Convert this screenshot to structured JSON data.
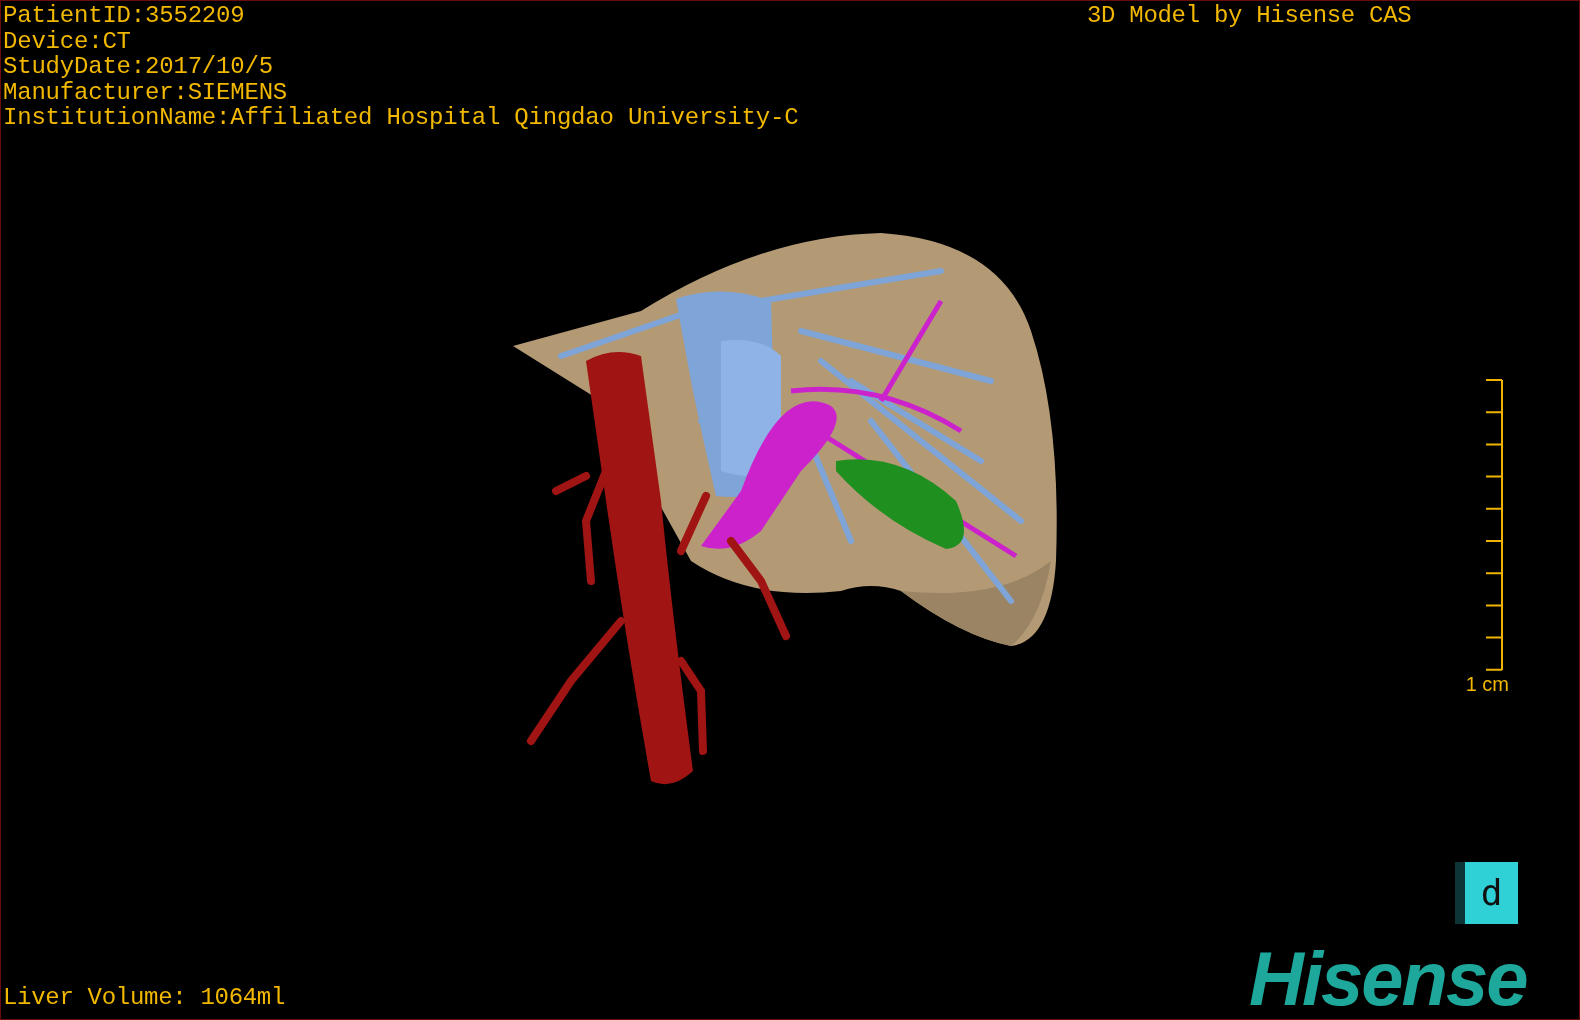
{
  "header_lines": [
    "PatientID:3552209",
    "Device:CT",
    "StudyDate:2017/10/5",
    "Manufacturer:SIEMENS",
    "InstitutionName:Affiliated Hospital Qingdao University-C"
  ],
  "model_caption": "3D Model by Hisense CAS",
  "scale": {
    "label": "1 cm"
  },
  "view_button": {
    "label": "d"
  },
  "logo": "Hisense",
  "footer": "Liver Volume: 1064ml"
}
